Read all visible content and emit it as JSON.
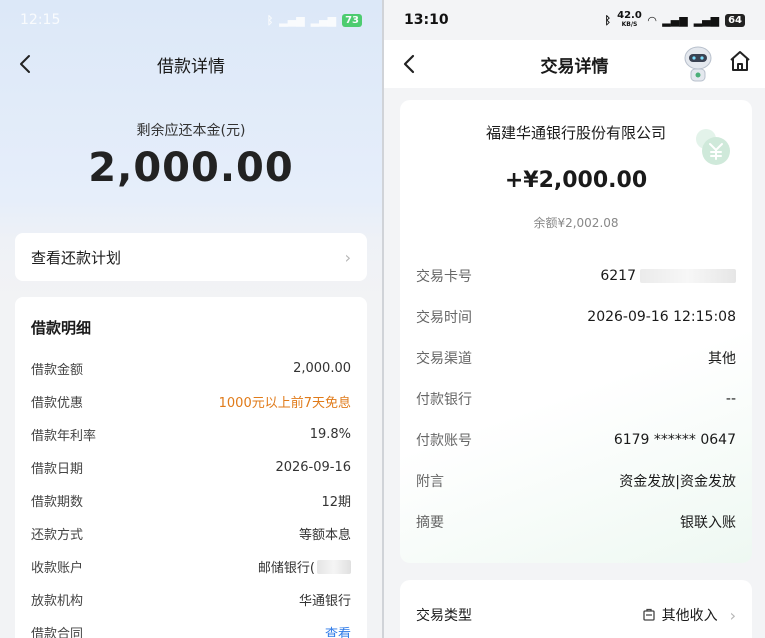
{
  "left": {
    "status": {
      "time": "12:15",
      "battery": "73"
    },
    "nav": {
      "title": "借款详情"
    },
    "summary": {
      "label": "剩余应还本金(元)",
      "amount": "2,000.00"
    },
    "plan": {
      "label": "查看还款计划"
    },
    "detail": {
      "title": "借款明细",
      "rows": [
        {
          "key": "借款金额",
          "value": "2,000.00"
        },
        {
          "key": "借款优惠",
          "value": "1000元以上前7天免息"
        },
        {
          "key": "借款年利率",
          "value": "19.8%"
        },
        {
          "key": "借款日期",
          "value": "2026-09-16"
        },
        {
          "key": "借款期数",
          "value": "12期"
        },
        {
          "key": "还款方式",
          "value": "等额本息"
        },
        {
          "key": "收款账户",
          "value": "邮储银行("
        },
        {
          "key": "放款机构",
          "value": "华通银行"
        },
        {
          "key": "借款合同",
          "value": "查看"
        }
      ]
    },
    "colors": {
      "accent_orange": "#e07b1a",
      "link_blue": "#2f7be8"
    }
  },
  "right": {
    "status": {
      "time": "13:10",
      "speed": "42.0",
      "speed_unit": "KB/S",
      "battery": "64"
    },
    "nav": {
      "title": "交易详情"
    },
    "card": {
      "company": "福建华通银行股份有限公司",
      "amount": "+¥2,000.00",
      "balance": "余额¥2,002.08",
      "rows": [
        {
          "key": "交易卡号",
          "value": "6217"
        },
        {
          "key": "交易时间",
          "value": "2026-09-16 12:15:08"
        },
        {
          "key": "交易渠道",
          "value": "其他"
        },
        {
          "key": "付款银行",
          "value": "--"
        },
        {
          "key": "付款账号",
          "value": "6179 ****** 0647"
        },
        {
          "key": "附言",
          "value": "资金发放|资金发放"
        },
        {
          "key": "摘要",
          "value": "银联入账"
        }
      ]
    },
    "type": {
      "key": "交易类型",
      "value": "其他收入"
    },
    "colors": {
      "accent_green": "#4caf78"
    }
  }
}
